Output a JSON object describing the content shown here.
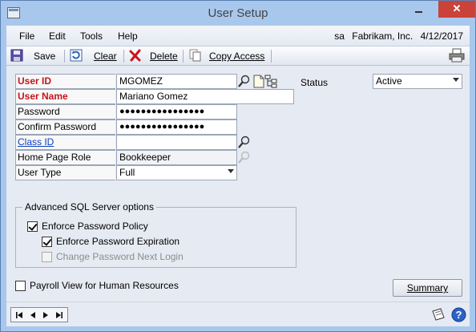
{
  "window": {
    "title": "User Setup"
  },
  "menu": {
    "items": [
      "File",
      "Edit",
      "Tools",
      "Help"
    ],
    "user": "sa",
    "company": "Fabrikam, Inc.",
    "date": "4/12/2017"
  },
  "toolbar": {
    "save": "Save",
    "clear": "Clear",
    "delete": "Delete",
    "copy_access": "Copy Access"
  },
  "form": {
    "user_id": {
      "label": "User ID",
      "value": "MGOMEZ"
    },
    "user_name": {
      "label": "User Name",
      "value": "Mariano Gomez"
    },
    "password": {
      "label": "Password",
      "value": "●●●●●●●●●●●●●●●●"
    },
    "confirm_password": {
      "label": "Confirm Password",
      "value": "●●●●●●●●●●●●●●●●"
    },
    "class_id": {
      "label": "Class ID",
      "value": ""
    },
    "home_page_role": {
      "label": "Home Page Role",
      "value": "Bookkeeper"
    },
    "user_type": {
      "label": "User Type",
      "value": "Full"
    },
    "status": {
      "label": "Status",
      "value": "Active"
    }
  },
  "sql_options": {
    "title": "Advanced SQL Server options",
    "enforce_policy": {
      "label": "Enforce Password Policy",
      "checked": true
    },
    "enforce_expiration": {
      "label": "Enforce Password Expiration",
      "checked": true
    },
    "change_next_login": {
      "label": "Change Password Next Login",
      "checked": false,
      "disabled": true
    }
  },
  "payroll_view": {
    "label": "Payroll View for Human Resources",
    "checked": false
  },
  "buttons": {
    "summary": "Summary"
  },
  "colors": {
    "required_label": "#c4151c",
    "link_label": "#0b3fbf",
    "title_bar": "#a8c7ec"
  }
}
